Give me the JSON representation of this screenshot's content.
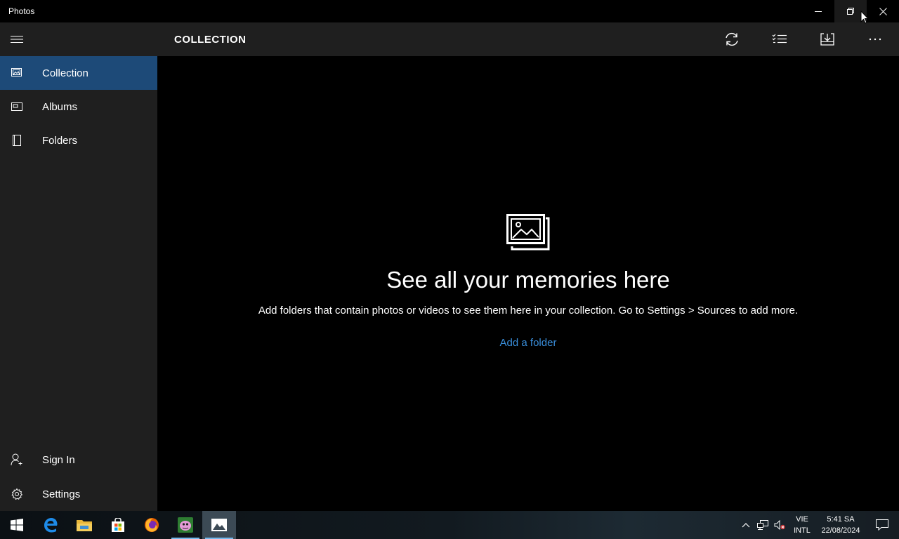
{
  "window": {
    "title": "Photos",
    "controls": {
      "minimize": "minimize-icon",
      "restore": "restore-icon",
      "close": "close-icon"
    }
  },
  "sidebar": {
    "menu_icon": "hamburger-icon",
    "items": [
      {
        "label": "Collection",
        "icon": "collection-icon",
        "selected": true
      },
      {
        "label": "Albums",
        "icon": "album-icon",
        "selected": false
      },
      {
        "label": "Folders",
        "icon": "folder-icon",
        "selected": false
      }
    ],
    "bottom": [
      {
        "label": "Sign In",
        "icon": "person-add-icon"
      },
      {
        "label": "Settings",
        "icon": "gear-icon"
      }
    ]
  },
  "header": {
    "title": "COLLECTION",
    "toolbar": [
      "refresh-icon",
      "select-icon",
      "import-icon",
      "more-icon"
    ]
  },
  "main": {
    "empty_icon": "photos-stack-icon",
    "title": "See all your memories here",
    "description": "Add folders that contain photos or videos to see them here in your collection. Go to Settings > Sources to add more.",
    "link": "Add a folder"
  },
  "taskbar": {
    "apps": [
      "windows-start-icon",
      "edge-icon",
      "file-explorer-icon",
      "store-icon",
      "firefox-icon",
      "app-icon",
      "photos-icon"
    ],
    "tray": {
      "lang_line1": "VIE",
      "lang_line2": "INTL",
      "time": "5:41 SA",
      "date": "22/08/2024"
    }
  },
  "colors": {
    "accent": "#1d4a78",
    "link": "#3a8fdc",
    "sidebar_bg": "#1f1f1f",
    "main_bg": "#000000"
  }
}
